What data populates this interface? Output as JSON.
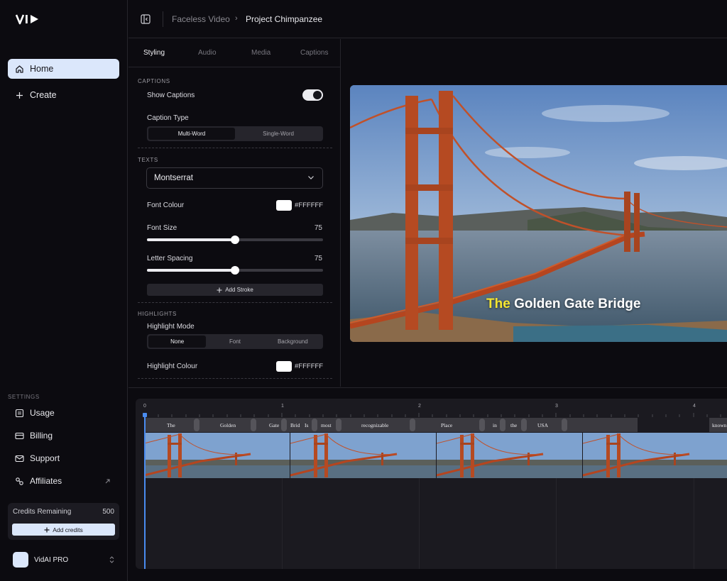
{
  "app": {
    "logo_text": "VI▶"
  },
  "sidebar": {
    "home_label": "Home",
    "create_label": "Create",
    "settings_label": "SETTINGS",
    "settings_items": [
      {
        "label": "Usage",
        "icon": "usage-icon"
      },
      {
        "label": "Billing",
        "icon": "billing-icon"
      },
      {
        "label": "Support",
        "icon": "support-icon"
      },
      {
        "label": "Affiliates",
        "icon": "affiliates-icon"
      }
    ],
    "credits_label": "Credits Remaining",
    "credits_value": "500",
    "add_credits_label": "Add credits",
    "user_name": "VidAI PRO"
  },
  "topbar": {
    "breadcrumb_parent": "Faceless Video",
    "breadcrumb_current": "Project Chimpanzee"
  },
  "panel": {
    "tabs": [
      "Styling",
      "Audio",
      "Media",
      "Captions"
    ],
    "active_tab": "Styling",
    "captions": {
      "section_title": "CAPTIONS",
      "show_captions_label": "Show Captions",
      "show_captions_on": true,
      "caption_type_label": "Caption Type",
      "caption_type_options": [
        "Multi-Word",
        "Single-Word"
      ],
      "caption_type_selected": "Multi-Word"
    },
    "texts": {
      "section_title": "TEXTS",
      "font_family": "Montserrat",
      "font_colour_label": "Font Colour",
      "font_colour": "#FFFFFF",
      "font_size_label": "Font Size",
      "font_size": "75",
      "font_size_fraction": 0.5,
      "letter_spacing_label": "Letter Spacing",
      "letter_spacing": "75",
      "letter_spacing_fraction": 0.5,
      "add_stroke_label": "Add Stroke"
    },
    "highlights": {
      "section_title": "HIGHLIGHTS",
      "mode_label": "Highlight Mode",
      "mode_options": [
        "None",
        "Font",
        "Background"
      ],
      "mode_selected": "None",
      "colour_label": "Highlight Colour",
      "colour": "#FFFFFF"
    }
  },
  "preview": {
    "caption_highlight": "The",
    "caption_rest": "Golden Gate Bridge",
    "highlight_color": "#F5E531"
  },
  "timeline": {
    "ticks": [
      "0",
      "1",
      "2",
      "3",
      "4"
    ],
    "words": [
      "The",
      "Golden",
      "Gate",
      "Brid",
      "Is",
      "most",
      "recognizable",
      "Place",
      "in",
      "the",
      "USA",
      "known"
    ]
  },
  "colors": {
    "accent": "#DBE7FB",
    "background": "#0C0B10",
    "playhead": "#4A8CF0"
  }
}
